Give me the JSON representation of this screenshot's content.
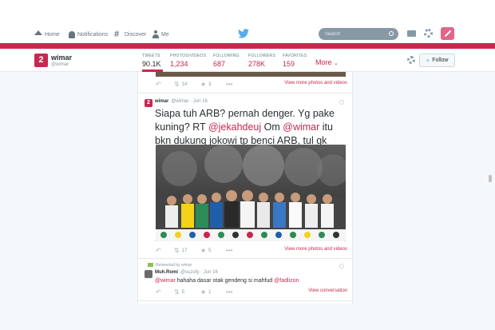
{
  "nav": {
    "home": "Home",
    "notifications": "Notifications",
    "discover": "Discover",
    "me": "Me",
    "search_placeholder": "Search"
  },
  "profile": {
    "avatar_text": "2",
    "name": "wimar",
    "handle": "@wimar",
    "stats": [
      {
        "label": "TWEETS",
        "value": "90.1K"
      },
      {
        "label": "PHOTOS/VIDEOS",
        "value": "1,234"
      },
      {
        "label": "FOLLOWING",
        "value": "687"
      },
      {
        "label": "FOLLOWERS",
        "value": "278K"
      },
      {
        "label": "FAVORITES",
        "value": "159"
      }
    ],
    "more": "More",
    "follow": "Follow"
  },
  "tweet0": {
    "retweets": "14",
    "favorites": "3",
    "view_media": "View more photos and videos"
  },
  "tweet1": {
    "name": "wimar",
    "meta": "@wimar · Jun 16",
    "text_a": "Siapa tuh ARB? pernah denger. Yg pake kuning? RT ",
    "mention_1": "@jekahdeuj",
    "text_b": " Om ",
    "mention_2": "@wimar",
    "text_c": " itu bkn dukung jokowi tp benci ARB, tul gk",
    "retweets": "17",
    "favorites": "5",
    "view_media": "View more photos and videos"
  },
  "tweet2": {
    "retweeted_by": "Retweeted by wimar",
    "name": "Muh.Romi",
    "meta": "@suzofy · Jun 16",
    "mention_1": "@wimar",
    "text": " hahaha dasar otak gendeng si mahfud ",
    "mention_2": "@fadlizon",
    "retweets": "5",
    "favorites": "1",
    "view_conversation": "View conversation"
  },
  "colors": {
    "brand": "#c7284f",
    "twitter_blue": "#55acee"
  }
}
